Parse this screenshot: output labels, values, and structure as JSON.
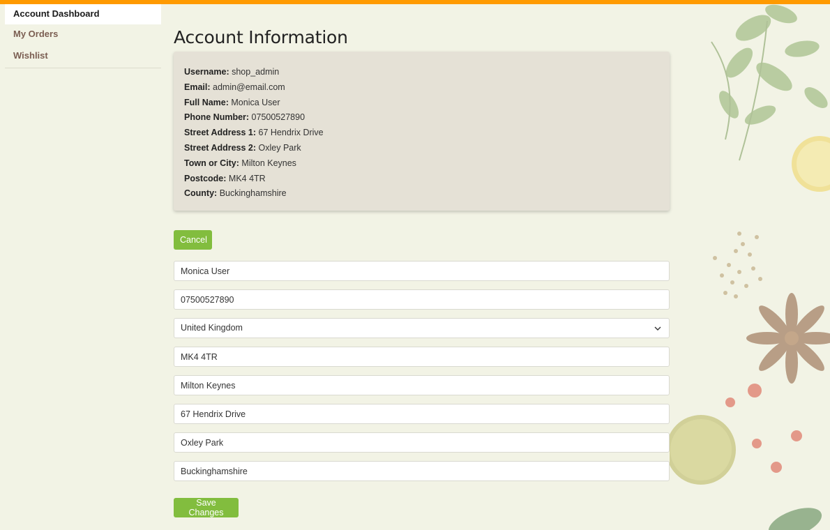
{
  "sidebar": {
    "items": [
      {
        "label": "Account Dashboard",
        "active": true
      },
      {
        "label": "My Orders",
        "active": false
      },
      {
        "label": "Wishlist",
        "active": false
      }
    ]
  },
  "main": {
    "title": "Account Information",
    "info": [
      {
        "label": "Username:",
        "value": "shop_admin"
      },
      {
        "label": "Email:",
        "value": "admin@email.com"
      },
      {
        "label": "Full Name:",
        "value": "Monica User"
      },
      {
        "label": "Phone Number:",
        "value": "07500527890"
      },
      {
        "label": "Street Address 1:",
        "value": "67 Hendrix Drive"
      },
      {
        "label": "Street Address 2:",
        "value": "Oxley Park"
      },
      {
        "label": "Town or City:",
        "value": "Milton Keynes"
      },
      {
        "label": "Postcode:",
        "value": "MK4 4TR"
      },
      {
        "label": "County:",
        "value": "Buckinghamshire"
      }
    ],
    "cancel_label": "Cancel",
    "save_label": "Save Changes",
    "form": {
      "full_name": "Monica User",
      "phone": "07500527890",
      "country": "United Kingdom",
      "postcode": "MK4 4TR",
      "town": "Milton Keynes",
      "street1": "67 Hendrix Drive",
      "street2": "Oxley Park",
      "county": "Buckinghamshire"
    }
  },
  "colors": {
    "accent_bar": "#ff9a00",
    "button": "#82bd3e",
    "background": "#f2f3e5",
    "card": "#e5e1d6",
    "sidebar_link": "#7b5e52"
  },
  "icons": [
    "chevron-down-icon"
  ]
}
